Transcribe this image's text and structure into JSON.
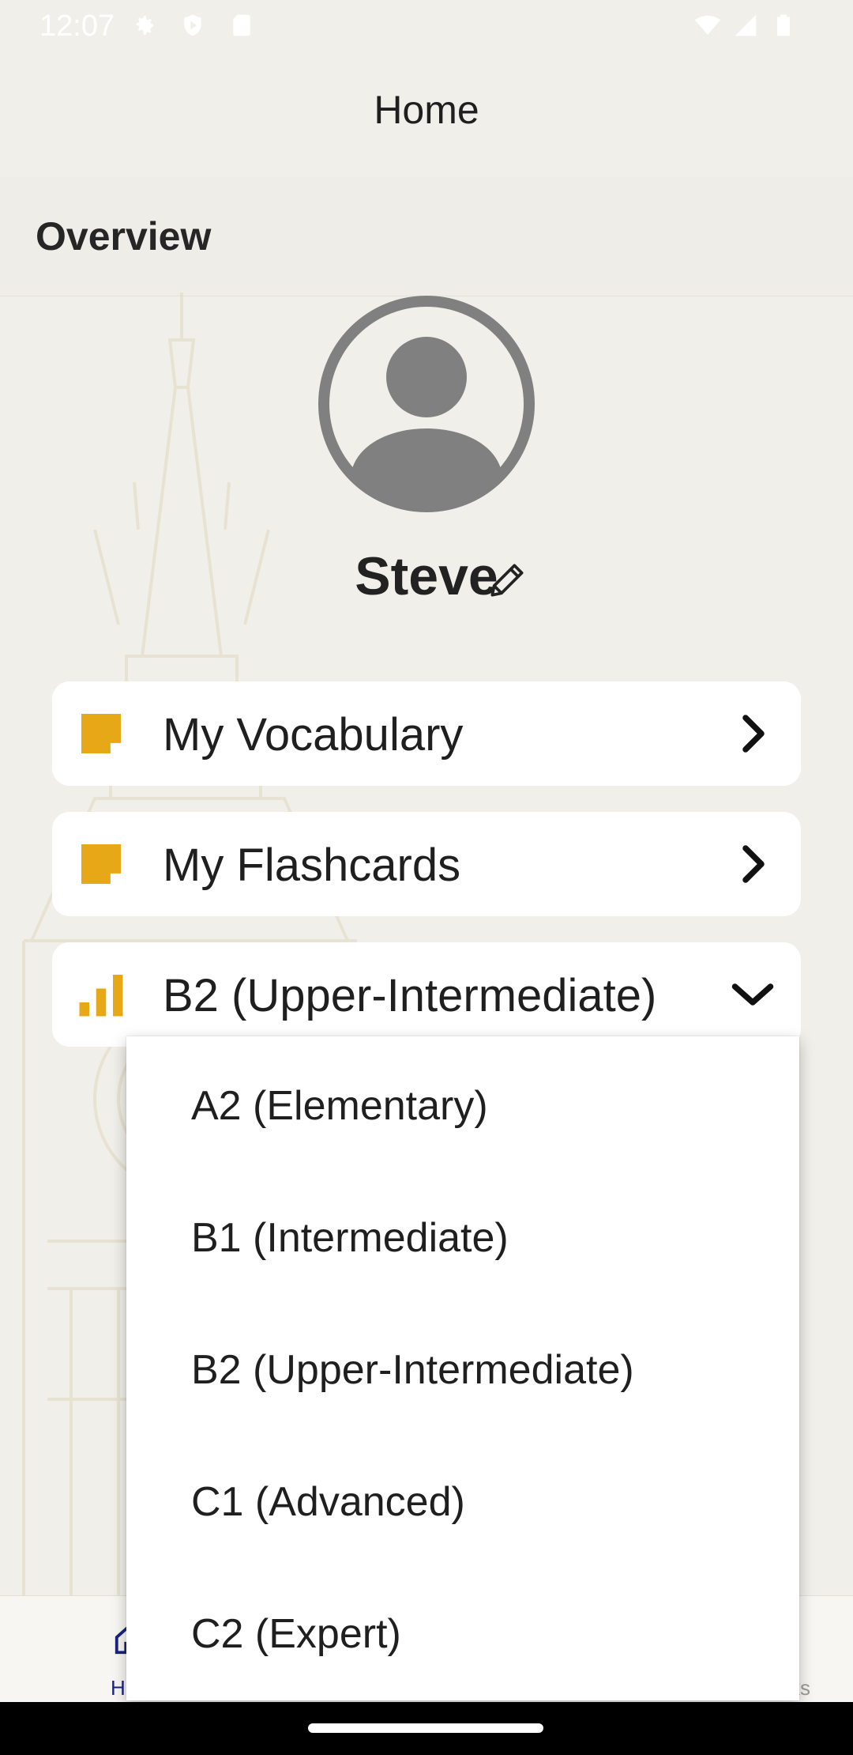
{
  "status_bar": {
    "time": "12:07",
    "icons": [
      "gear-icon",
      "shield-play-icon",
      "sd-card-icon",
      "wifi-icon",
      "signal-icon",
      "battery-icon"
    ]
  },
  "header": {
    "title": "Home"
  },
  "overview": {
    "label": "Overview"
  },
  "profile": {
    "name": "Steve",
    "avatar_icon": "person-avatar-icon",
    "edit_icon": "pencil-icon"
  },
  "cards": {
    "vocabulary": {
      "label": "My Vocabulary",
      "icon": "sticky-note-icon"
    },
    "flashcards": {
      "label": "My Flashcards",
      "icon": "sticky-note-icon"
    },
    "level": {
      "label": "B2 (Upper-Intermediate)",
      "icon": "bar-chart-icon",
      "expanded": true
    }
  },
  "level_dropdown": {
    "options": [
      "A2 (Elementary)",
      "B1 (Intermediate)",
      "B2 (Upper-Intermediate)",
      "C1 (Advanced)",
      "C2 (Expert)"
    ],
    "selected": "B2 (Upper-Intermediate)"
  },
  "bottom_nav": {
    "home_label_fragment": "H",
    "right_label_fragment": "ks"
  },
  "colors": {
    "background": "#f1efe9",
    "accent_yellow": "#e6a817",
    "avatar_gray": "#808080",
    "nav_active": "#1a237e"
  }
}
